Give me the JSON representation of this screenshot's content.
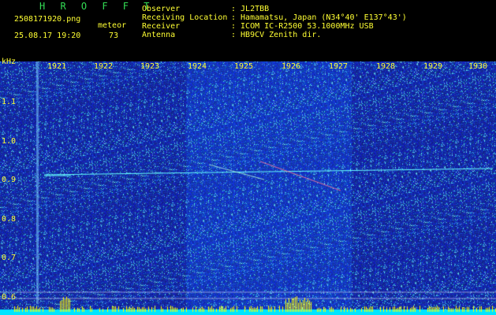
{
  "header": {
    "brand": "H R O F F T",
    "filename": "2508171920.png",
    "datetime": "25.08.17 19:20",
    "mode": "meteor",
    "count": "73",
    "info_labels": "Observer\nReceiving Location\nReceiver\nAntenna",
    "info_values": ": JL2TBB\n: Hamamatsu, Japan (N34°40' E137°43')\n: ICOM IC-R2500 53.1000MHz USB\n: HB9CV Zenith dir."
  },
  "axis": {
    "unit": "kHz",
    "x_ticks": [
      "1921",
      "1922",
      "1923",
      "1924",
      "1925",
      "1926",
      "1927",
      "1928",
      "1929",
      "1930"
    ],
    "y_ticks": [
      "1.1",
      "1.0",
      "0.9",
      "0.8",
      "0.7",
      "0.6"
    ]
  },
  "colors": {
    "label_yellow": "#ffff33",
    "brand_green": "#33dd55",
    "background_blue": "#10208c",
    "carrier_cyan": "#66ffff",
    "level_bar_yellow": "#ffff00",
    "baseline_cyan": "#00e5ff"
  }
}
